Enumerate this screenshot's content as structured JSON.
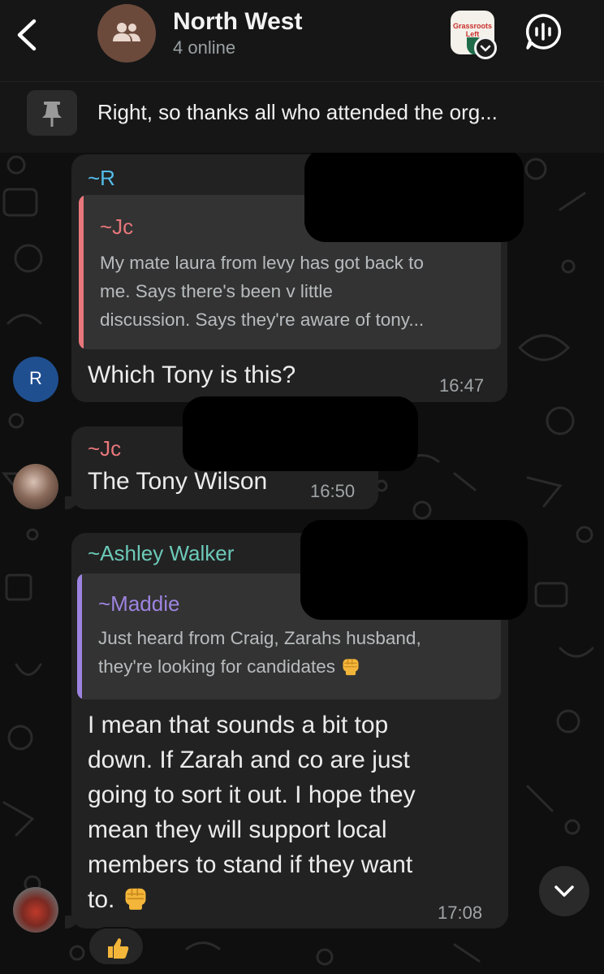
{
  "header": {
    "title": "North West",
    "subtitle": "4 online",
    "community_logo_text": "Grassroots Left"
  },
  "pinned": {
    "text": "Right, so thanks all who attended the org..."
  },
  "messages": [
    {
      "sender": "~R",
      "sender_color": "#53bdeb",
      "avatar_letter": "R",
      "quote": {
        "name": "~Jc",
        "name_color": "#e8777b",
        "lines": [
          "My mate laura from levy has got back to",
          "me. Says there's been v little",
          "discussion. Says they're aware of tony..."
        ]
      },
      "text": "Which Tony is this?",
      "time": "16:47"
    },
    {
      "sender": "~Jc",
      "sender_color": "#e8777b",
      "text": "The Tony Wilson",
      "time": "16:50"
    },
    {
      "sender": "~Ashley Walker",
      "sender_color": "#6cc9b8",
      "quote": {
        "name": "~Maddie",
        "name_color": "#9d84e0",
        "lines": [
          "Just heard from Craig, Zarahs husband,",
          "they're looking for candidates"
        ]
      },
      "lines": [
        "I mean that sounds a bit top",
        "down. If Zarah and co are just",
        "going to sort it out. I hope they",
        "mean they will support local",
        "members to stand if they want",
        "to."
      ],
      "time": "17:08",
      "reaction": "thumbs-up"
    }
  ],
  "colors": {
    "header_bg": "#161616",
    "bubble_bg": "#222222",
    "quote_bg": "#333333",
    "r_avatar_bg": "#1f4f8f"
  }
}
